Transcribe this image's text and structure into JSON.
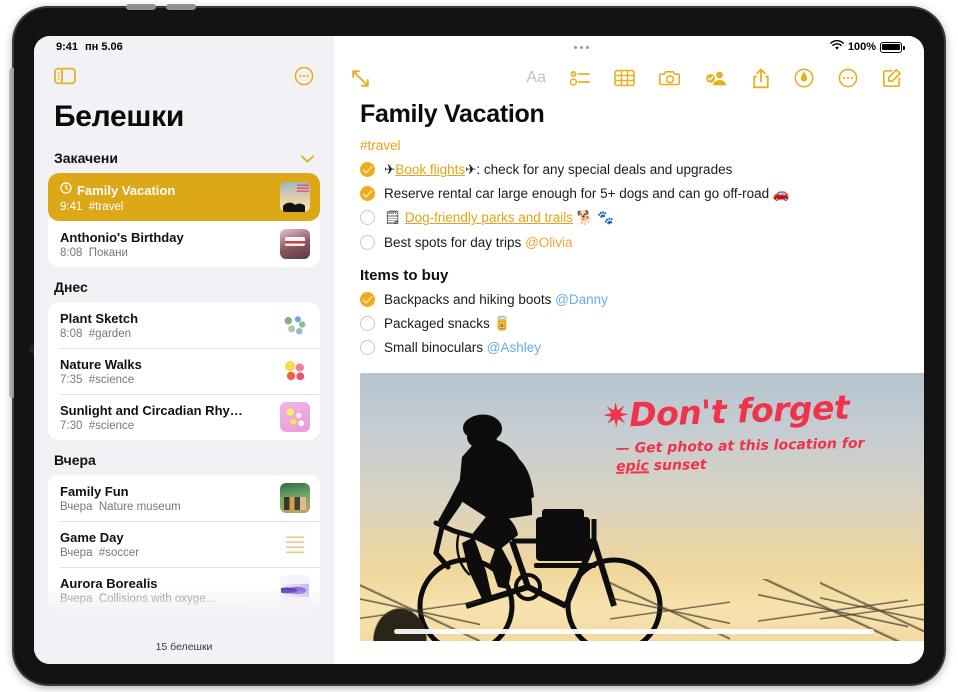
{
  "status_bar": {
    "time": "9:41",
    "date": "пн 5.06",
    "wifi_icon": "wifi-icon",
    "battery_percent": "100%",
    "multitask_handle": "multitask-handle-icon"
  },
  "sidebar": {
    "toggle_icon": "sidebar-toggle-icon",
    "more_icon": "more-ellipsis-circle-icon",
    "title": "Белешки",
    "footer_count": "15 белешки",
    "sections": [
      {
        "header": "Закачени",
        "collapse_icon": "chevron-down-icon",
        "notes": [
          {
            "title": "Family Vacation",
            "time": "9:41",
            "detail": "#travel",
            "selected": true,
            "pinned_icon": "pin-clock-icon",
            "thumb": "cyclist-sunset-thumb"
          },
          {
            "title": "Anthonio's Birthday",
            "time": "8:08",
            "detail": "Покани",
            "selected": false,
            "thumb": "birthday-cake-thumb"
          }
        ]
      },
      {
        "header": "Днес",
        "notes": [
          {
            "title": "Plant Sketch",
            "time": "8:08",
            "detail": "#garden",
            "selected": false,
            "thumb": "plant-sketch-thumb"
          },
          {
            "title": "Nature Walks",
            "time": "7:35",
            "detail": "#science",
            "selected": false,
            "thumb": "colorful-shapes-thumb"
          },
          {
            "title": "Sunlight and Circadian Rhy…",
            "time": "7:30",
            "detail": "#science",
            "selected": false,
            "thumb": "pink-confetti-thumb"
          }
        ]
      },
      {
        "header": "Вчера",
        "notes": [
          {
            "title": "Family Fun",
            "time": "Вчера",
            "detail": "Nature museum",
            "selected": false,
            "thumb": "museum-photo-thumb"
          },
          {
            "title": "Game Day",
            "time": "Вчера",
            "detail": "#soccer",
            "selected": false,
            "thumb": "document-thumb"
          },
          {
            "title": "Aurora Borealis",
            "time": "Вчера",
            "detail": "Collisions with oxyge…",
            "selected": false,
            "thumb": "aurora-thumb"
          }
        ]
      }
    ]
  },
  "detail": {
    "expand_icon": "expand-arrows-icon",
    "toolbar": [
      {
        "name": "format-aa-icon",
        "label": "Aa",
        "disabled": true
      },
      {
        "name": "checklist-icon",
        "label": "",
        "disabled": false
      },
      {
        "name": "table-icon",
        "label": "",
        "disabled": false
      },
      {
        "name": "camera-icon",
        "label": "",
        "disabled": false
      },
      {
        "name": "collaborate-person-icon",
        "label": "",
        "disabled": false
      },
      {
        "name": "share-icon",
        "label": "",
        "disabled": false
      },
      {
        "name": "markup-pen-icon",
        "label": "",
        "disabled": false
      },
      {
        "name": "more-ellipsis-circle-icon",
        "label": "",
        "disabled": false
      },
      {
        "name": "compose-new-note-icon",
        "label": "",
        "disabled": false
      }
    ],
    "note": {
      "title": "Family Vacation",
      "hashtag": "#travel",
      "checklist": [
        {
          "checked": true,
          "prefix_emoji": "✈",
          "link_text": "Book flights",
          "suffix_emoji": "✈",
          "rest": ": check for any special deals and upgrades"
        },
        {
          "checked": true,
          "text": "Reserve rental car large enough for 5+ dogs and can go off-road ",
          "trailing_emoji": "🚗"
        },
        {
          "checked": false,
          "note_icon": "🗒",
          "link_text": "Dog-friendly parks and trails",
          "trailing_emoji": " 🐕 🐾"
        },
        {
          "checked": false,
          "text": "Best spots for day trips ",
          "mention": "@Olivia",
          "mention_color": "orange"
        }
      ],
      "section_title": "Items to buy",
      "buy_list": [
        {
          "checked": true,
          "text": "Backpacks and hiking boots ",
          "mention": "@Danny",
          "mention_color": "blue"
        },
        {
          "checked": false,
          "text": "Packaged snacks ",
          "trailing_emoji": "🥫"
        },
        {
          "checked": false,
          "text": "Small binoculars ",
          "mention": "@Ashley",
          "mention_color": "blue"
        }
      ],
      "photo": {
        "name": "cyclist-sunset-photo",
        "handwriting_line1": "✷Don't forget",
        "handwriting_line2_a": "— Get photo at this location for ",
        "handwriting_line2_underline": "epic",
        "handwriting_line2_b": " sunset",
        "handwriting_color": "#f0324a"
      }
    }
  },
  "colors": {
    "accent_gold": "#e8b020",
    "selected_row": "#dda818",
    "sidebar_bg": "#f2f1f6",
    "mention_blue": "#6aaaf0",
    "mention_orange": "#f0a23c",
    "checkbox_on": "#f2ab1c"
  }
}
